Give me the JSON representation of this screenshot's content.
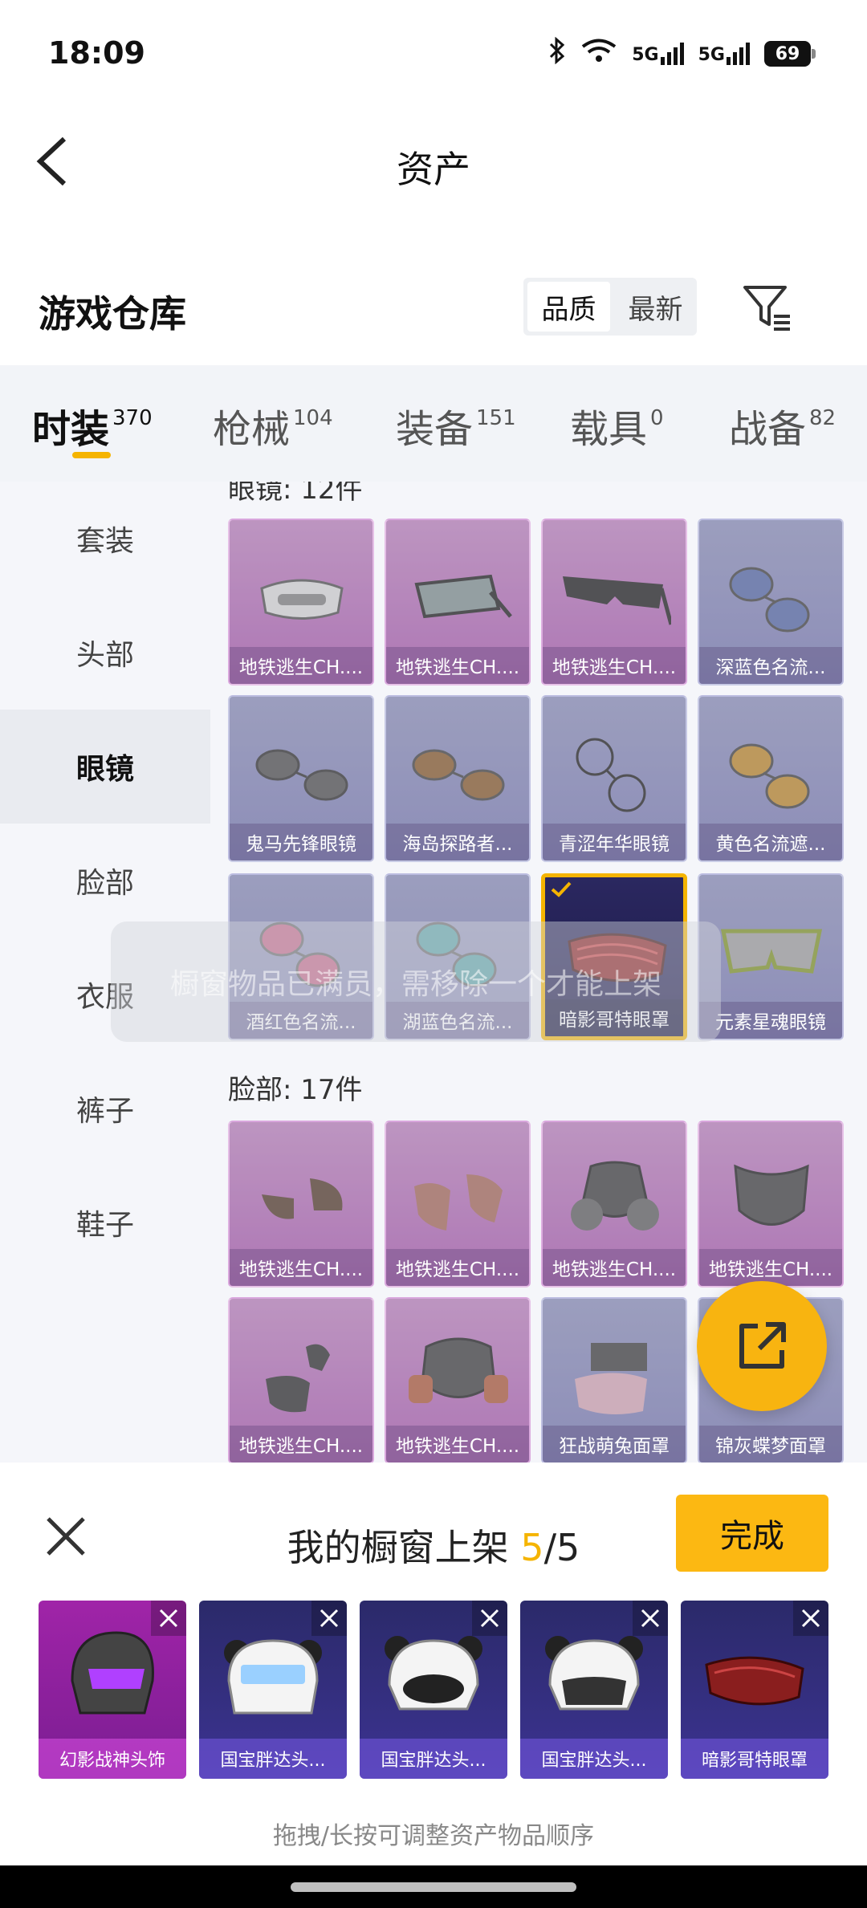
{
  "status_bar": {
    "time": "18:09",
    "net1": "5G",
    "net2": "5G",
    "battery": "69"
  },
  "header": {
    "title": "资产"
  },
  "section": {
    "title": "游戏仓库",
    "sort_options": [
      "品质",
      "最新"
    ]
  },
  "tabs": [
    {
      "label": "时装",
      "count": "370"
    },
    {
      "label": "枪械",
      "count": "104"
    },
    {
      "label": "装备",
      "count": "151"
    },
    {
      "label": "载具",
      "count": "0"
    },
    {
      "label": "战备",
      "count": "82"
    }
  ],
  "sidebar": {
    "items": [
      "套装",
      "头部",
      "眼镜",
      "脸部",
      "衣服",
      "裤子",
      "鞋子"
    ]
  },
  "groups": {
    "glasses_title": "眼镜: 12件",
    "face_title": "脸部: 17件"
  },
  "glasses_items": [
    "地铁逃生CH....",
    "地铁逃生CH....",
    "地铁逃生CH....",
    "深蓝色名流...",
    "鬼马先锋眼镜",
    "海岛探路者...",
    "青涩年华眼镜",
    "黄色名流遮...",
    "酒红色名流...",
    "湖蓝色名流...",
    "暗影哥特眼罩",
    "元素星魂眼镜"
  ],
  "face_items": [
    "地铁逃生CH....",
    "地铁逃生CH....",
    "地铁逃生CH....",
    "地铁逃生CH....",
    "地铁逃生CH....",
    "地铁逃生CH....",
    "狂战萌兔面罩",
    "锦灰蝶梦面罩"
  ],
  "toast": "橱窗物品已满员，需移除一个才能上架",
  "panel": {
    "title_prefix": "我的橱窗上架 ",
    "count": "5",
    "total": "/5",
    "done_label": "完成",
    "slots": [
      "幻影战神头饰",
      "国宝胖达头...",
      "国宝胖达头...",
      "国宝胖达头...",
      "暗影哥特眼罩"
    ],
    "hint": "拖拽/长按可调整资产物品顺序"
  },
  "colors": {
    "accent": "#f5b400",
    "legendary": "#c06cc6",
    "epic": "#8e8fcb"
  }
}
